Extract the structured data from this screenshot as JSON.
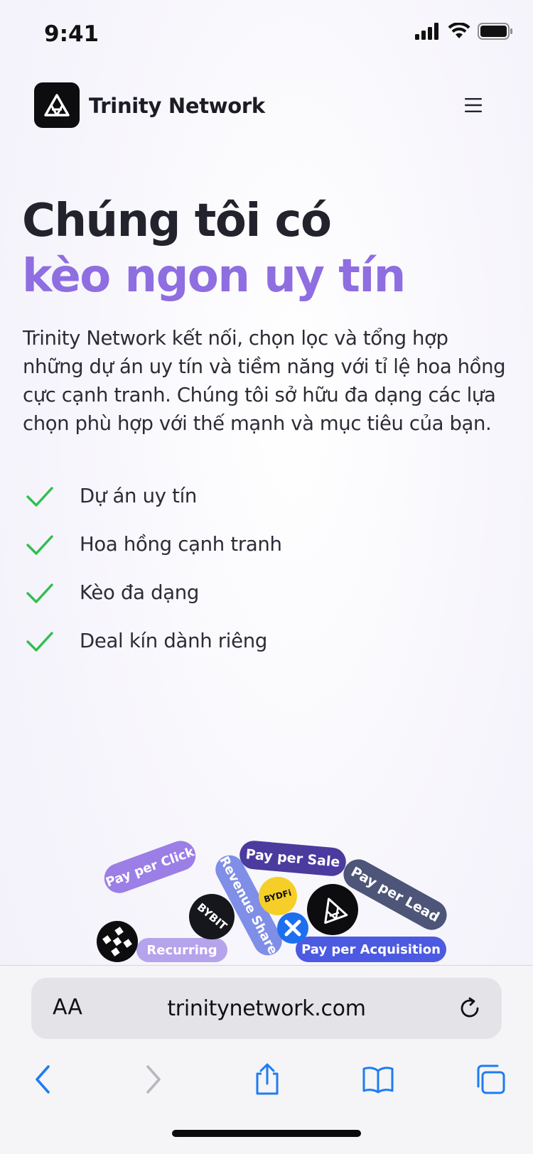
{
  "status": {
    "time": "9:41"
  },
  "nav": {
    "brand": "Trinity Network"
  },
  "hero": {
    "title_line1": "Chúng tôi có",
    "title_line2": "kèo ngon uy tín",
    "description": "Trinity Network kết nối, chọn lọc và tổng hợp những dự án uy tín và tiềm năng với tỉ lệ hoa hồng cực cạnh tranh. Chúng tôi sở hữu đa dạng các lựa chọn phù hợp với thế mạnh và mục tiêu của bạn."
  },
  "features": [
    {
      "label": "Dự án uy tín"
    },
    {
      "label": "Hoa hồng cạnh tranh"
    },
    {
      "label": "Kèo đa dạng"
    },
    {
      "label": "Deal kín dành riêng"
    }
  ],
  "pile": {
    "pills": {
      "pay_per_click": "Pay per Click",
      "recurring": "Recurring",
      "revenue_share": "Revenue Share",
      "pay_per_sale": "Pay per Sale",
      "pay_per_lead": "Pay per Lead",
      "pay_per_acquisition": "Pay per Acquisition"
    },
    "coins": {
      "bybit": "BYBIT",
      "bydfi": "BYDFi"
    }
  },
  "browser": {
    "aa_label": "AA",
    "url": "trinitynetwork.com"
  },
  "colors": {
    "accent": "#8e6ee0",
    "check": "#2fbf4f",
    "link_blue": "#1e7cf2"
  }
}
